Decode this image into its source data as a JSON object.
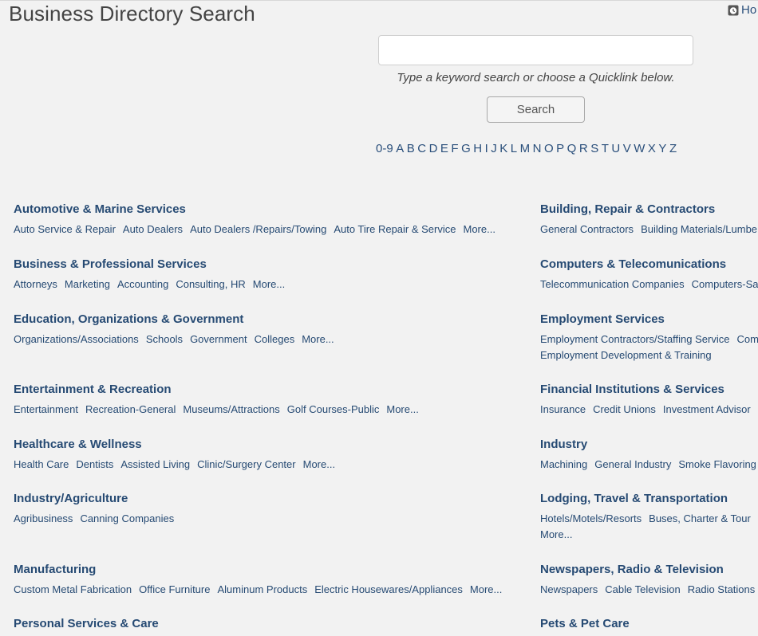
{
  "header": {
    "title": "Business Directory Search",
    "hours_label": "Ho"
  },
  "search": {
    "value": "",
    "placeholder": "",
    "hint": "Type a keyword search or choose a Quicklink below.",
    "button_label": "Search"
  },
  "alphabet": [
    "0-9",
    "A",
    "B",
    "C",
    "D",
    "E",
    "F",
    "G",
    "H",
    "I",
    "J",
    "K",
    "L",
    "M",
    "N",
    "O",
    "P",
    "Q",
    "R",
    "S",
    "T",
    "U",
    "V",
    "W",
    "X",
    "Y",
    "Z"
  ],
  "categories": {
    "left": [
      {
        "title": "Automotive & Marine Services",
        "links": [
          "Auto Service & Repair",
          "Auto Dealers",
          "Auto Dealers /Repairs/Towing",
          "Auto Tire Repair & Service",
          "More..."
        ]
      },
      {
        "title": "Business & Professional Services",
        "links": [
          "Attorneys",
          "Marketing",
          "Accounting",
          "Consulting, HR",
          "More..."
        ]
      },
      {
        "title": "Education, Organizations & Government",
        "links": [
          "Organizations/Associations",
          "Schools",
          "Government",
          "Colleges",
          "More..."
        ]
      },
      {
        "title": "Entertainment & Recreation",
        "links": [
          "Entertainment",
          "Recreation-General",
          "Museums/Attractions",
          "Golf Courses-Public",
          "More..."
        ]
      },
      {
        "title": "Healthcare & Wellness",
        "links": [
          "Health Care",
          "Dentists",
          "Assisted Living",
          "Clinic/Surgery Center",
          "More..."
        ]
      },
      {
        "title": "Industry/Agriculture",
        "links": [
          "Agribusiness",
          "Canning Companies"
        ]
      },
      {
        "title": "Manufacturing",
        "links": [
          "Custom Metal Fabrication",
          "Office Furniture",
          "Aluminum Products",
          "Electric Housewares/Appliances",
          "More..."
        ]
      },
      {
        "title": "Personal Services & Care",
        "links": []
      }
    ],
    "right": [
      {
        "title": "Building, Repair & Contractors",
        "links": [
          "General Contractors",
          "Building Materials/Lumbe"
        ]
      },
      {
        "title": "Computers & Telecomunications",
        "links": [
          "Telecommunication Companies",
          "Computers-Sa"
        ]
      },
      {
        "title": "Employment Services",
        "links": [
          "Employment Contractors/Staffing Service",
          "Com"
        ],
        "links2": [
          "Employment Development & Training"
        ]
      },
      {
        "title": "Financial Institutions & Services",
        "links": [
          "Insurance",
          "Credit Unions",
          "Investment Advisor"
        ]
      },
      {
        "title": "Industry",
        "links": [
          "Machining",
          "General Industry",
          "Smoke Flavoring"
        ]
      },
      {
        "title": "Lodging, Travel & Transportation",
        "links": [
          "Hotels/Motels/Resorts",
          "Buses, Charter & Tour"
        ],
        "links2": [
          "More..."
        ]
      },
      {
        "title": "Newspapers, Radio & Television",
        "links": [
          "Newspapers",
          "Cable Television",
          "Radio Stations"
        ]
      },
      {
        "title": "Pets & Pet Care",
        "links": []
      }
    ]
  }
}
